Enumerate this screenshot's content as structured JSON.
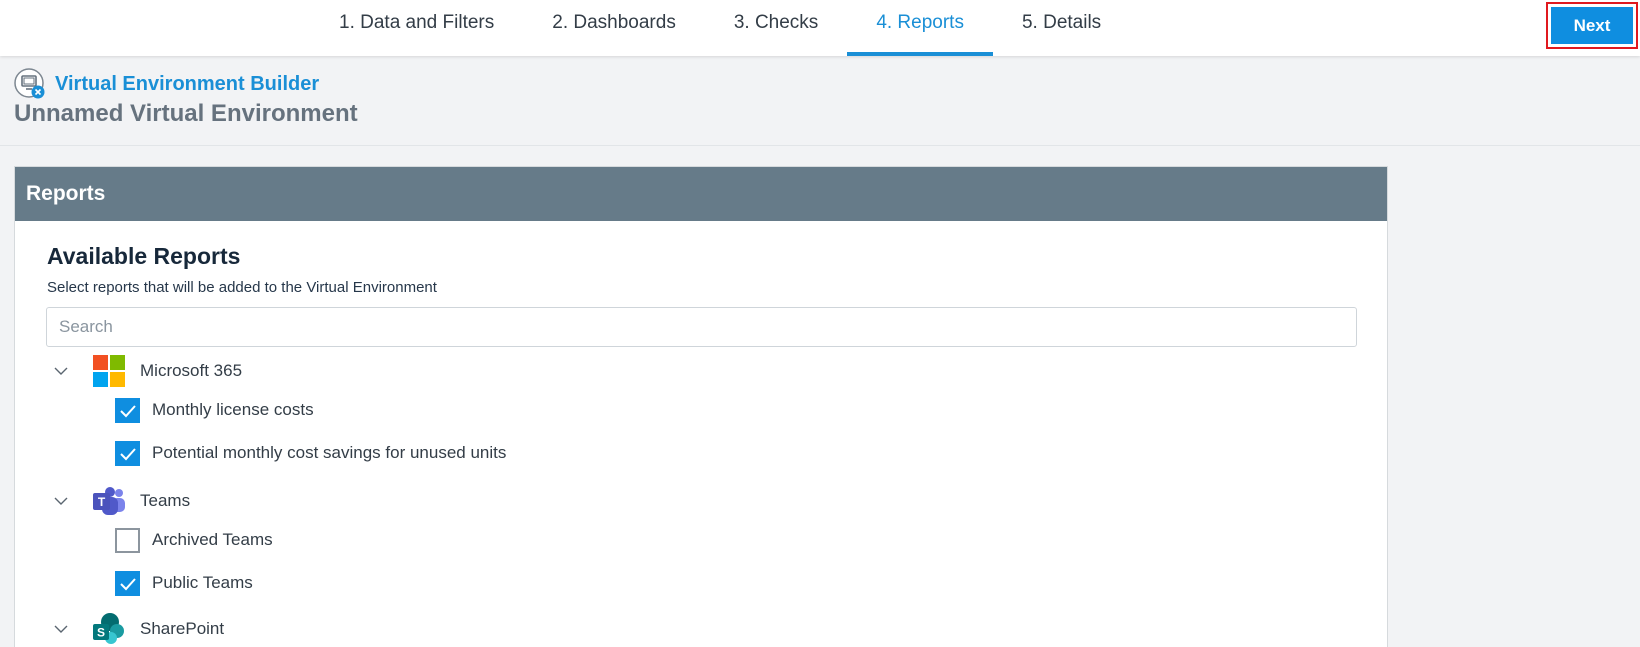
{
  "nav": {
    "steps": [
      {
        "label": "1. Data and Filters"
      },
      {
        "label": "2. Dashboards"
      },
      {
        "label": "3. Checks"
      },
      {
        "label": "4. Reports"
      },
      {
        "label": "5. Details"
      }
    ],
    "active_step": "4. Reports",
    "next_label": "Next"
  },
  "header": {
    "builder_title": "Virtual Environment Builder",
    "environment_name": "Unnamed Virtual Environment"
  },
  "panel": {
    "title": "Reports",
    "available_title": "Available Reports",
    "available_subtitle": "Select reports that will be added to the Virtual Environment",
    "search_placeholder": "Search",
    "groups": [
      {
        "label": "Microsoft 365",
        "icon": "microsoft-365-icon",
        "expanded": true,
        "items": [
          {
            "label": "Monthly license costs",
            "checked": true
          },
          {
            "label": "Potential monthly cost savings for unused units",
            "checked": true
          }
        ]
      },
      {
        "label": "Teams",
        "icon": "teams-icon",
        "expanded": true,
        "items": [
          {
            "label": "Archived Teams",
            "checked": false
          },
          {
            "label": "Public Teams",
            "checked": true
          }
        ]
      },
      {
        "label": "SharePoint",
        "icon": "sharepoint-icon",
        "expanded": true,
        "items": []
      }
    ]
  },
  "colors": {
    "accent": "#1a8fd6",
    "button": "#0f8ee0",
    "panel_header": "#667b89",
    "highlight_border": "#e0191f"
  }
}
